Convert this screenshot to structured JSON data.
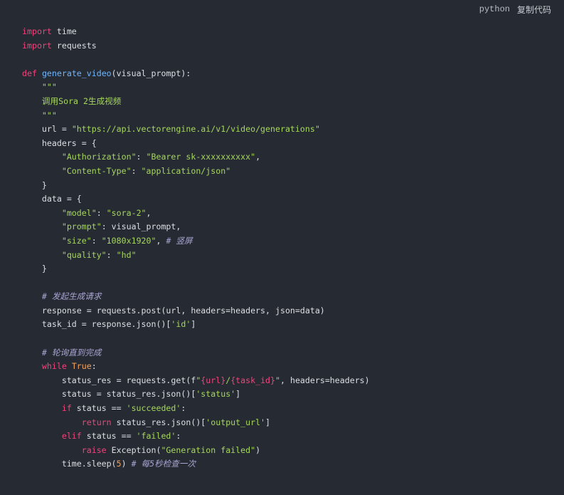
{
  "toolbar": {
    "language": "python",
    "copy_label": "复制代码"
  },
  "code_lines": [
    [
      [
        "k",
        "import"
      ],
      [
        "p",
        " time"
      ]
    ],
    [
      [
        "k",
        "import"
      ],
      [
        "p",
        " requests"
      ]
    ],
    [],
    [
      [
        "k",
        "def"
      ],
      [
        "p",
        " "
      ],
      [
        "f",
        "generate_video"
      ],
      [
        "p",
        "(visual_prompt):"
      ]
    ],
    [
      [
        "p",
        "    "
      ],
      [
        "s",
        "\"\"\""
      ]
    ],
    [
      [
        "p",
        "    "
      ],
      [
        "s",
        "调用Sora 2生成视频"
      ]
    ],
    [
      [
        "p",
        "    "
      ],
      [
        "s",
        "\"\"\""
      ]
    ],
    [
      [
        "p",
        "    url = "
      ],
      [
        "s",
        "\"https://api.vectorengine.ai/v1/video/generations\""
      ]
    ],
    [
      [
        "p",
        "    headers = {"
      ]
    ],
    [
      [
        "p",
        "        "
      ],
      [
        "s",
        "\"Authorization\""
      ],
      [
        "p",
        ": "
      ],
      [
        "s",
        "\"Bearer sk-xxxxxxxxxx\""
      ],
      [
        "p",
        ","
      ]
    ],
    [
      [
        "p",
        "        "
      ],
      [
        "s",
        "\"Content-Type\""
      ],
      [
        "p",
        ": "
      ],
      [
        "s",
        "\"application/json\""
      ]
    ],
    [
      [
        "p",
        "    }"
      ]
    ],
    [
      [
        "p",
        "    data = {"
      ]
    ],
    [
      [
        "p",
        "        "
      ],
      [
        "s",
        "\"model\""
      ],
      [
        "p",
        ": "
      ],
      [
        "s",
        "\"sora-2\""
      ],
      [
        "p",
        ","
      ]
    ],
    [
      [
        "p",
        "        "
      ],
      [
        "s",
        "\"prompt\""
      ],
      [
        "p",
        ": visual_prompt,"
      ]
    ],
    [
      [
        "p",
        "        "
      ],
      [
        "s",
        "\"size\""
      ],
      [
        "p",
        ": "
      ],
      [
        "s",
        "\"1080x1920\""
      ],
      [
        "p",
        ", "
      ],
      [
        "c",
        "# 竖屏"
      ]
    ],
    [
      [
        "p",
        "        "
      ],
      [
        "s",
        "\"quality\""
      ],
      [
        "p",
        ": "
      ],
      [
        "s",
        "\"hd\""
      ]
    ],
    [
      [
        "p",
        "    }"
      ]
    ],
    [],
    [
      [
        "p",
        "    "
      ],
      [
        "c",
        "# 发起生成请求"
      ]
    ],
    [
      [
        "p",
        "    response = requests.post(url, headers=headers, json=data)"
      ]
    ],
    [
      [
        "p",
        "    task_id = response.json()["
      ],
      [
        "s",
        "'id'"
      ],
      [
        "p",
        "]"
      ]
    ],
    [],
    [
      [
        "p",
        "    "
      ],
      [
        "c",
        "# 轮询直到完成"
      ]
    ],
    [
      [
        "p",
        "    "
      ],
      [
        "k",
        "while"
      ],
      [
        "p",
        " "
      ],
      [
        "n",
        "True"
      ],
      [
        "p",
        ":"
      ]
    ],
    [
      [
        "p",
        "        status_res = requests.get(f"
      ],
      [
        "s",
        "\""
      ],
      [
        "i",
        "{url}"
      ],
      [
        "s",
        "/"
      ],
      [
        "i",
        "{task_id}"
      ],
      [
        "s",
        "\""
      ],
      [
        "p",
        ", headers=headers)"
      ]
    ],
    [
      [
        "p",
        "        status = status_res.json()["
      ],
      [
        "s",
        "'status'"
      ],
      [
        "p",
        "]"
      ]
    ],
    [
      [
        "p",
        "        "
      ],
      [
        "k",
        "if"
      ],
      [
        "p",
        " status == "
      ],
      [
        "s",
        "'succeeded'"
      ],
      [
        "p",
        ":"
      ]
    ],
    [
      [
        "p",
        "            "
      ],
      [
        "k",
        "return"
      ],
      [
        "p",
        " status_res.json()["
      ],
      [
        "s",
        "'output_url'"
      ],
      [
        "p",
        "]"
      ]
    ],
    [
      [
        "p",
        "        "
      ],
      [
        "k",
        "elif"
      ],
      [
        "p",
        " status == "
      ],
      [
        "s",
        "'failed'"
      ],
      [
        "p",
        ":"
      ]
    ],
    [
      [
        "p",
        "            "
      ],
      [
        "k",
        "raise"
      ],
      [
        "p",
        " Exception("
      ],
      [
        "s",
        "\"Generation failed\""
      ],
      [
        "p",
        ")"
      ]
    ],
    [
      [
        "p",
        "        time.sleep("
      ],
      [
        "n",
        "5"
      ],
      [
        "p",
        ") "
      ],
      [
        "c",
        "# 每5秒检查一次"
      ]
    ]
  ]
}
